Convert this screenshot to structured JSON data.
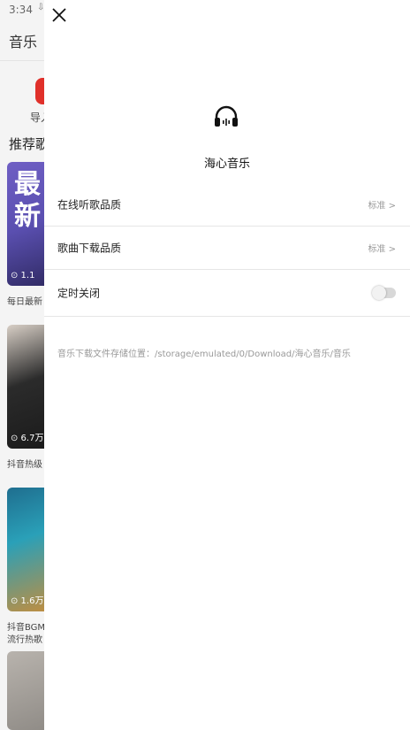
{
  "status_bar": {
    "time": "3:34",
    "left_icons": "⇩ ⇩ ▣",
    "right_icons": "▼◢▮"
  },
  "background": {
    "title": "音乐",
    "shortcut_label": "导入",
    "section_title": "推荐歌",
    "card_1_text": "最新",
    "card_1_caption": "每日最新",
    "card_2_caption": "抖音热级",
    "card_3_caption_line1": "抖音BGM",
    "card_3_caption_line2": "流行热歌",
    "card_play_1": "⊙ 1.1",
    "card_play_2": "⊙ 6.7万",
    "card_play_3": "⊙ 1.6万"
  },
  "drawer": {
    "app_name": "海心音乐",
    "rows": [
      {
        "label": "在线听歌品质",
        "value": "标准 >"
      },
      {
        "label": "歌曲下载品质",
        "value": "标准 >"
      },
      {
        "label": "定时关闭",
        "toggle_on": false
      }
    ],
    "storage_path": "音乐下载文件存储位置：/storage/emulated/0/Download/海心音乐/音乐"
  }
}
